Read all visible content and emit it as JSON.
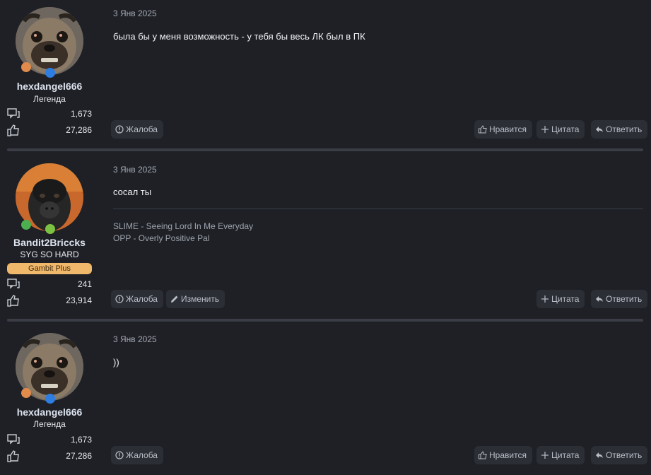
{
  "posts": [
    {
      "user": {
        "name": "hexdangel666",
        "title": "Легенда",
        "messages": "1,673",
        "reactions": "27,286"
      },
      "date": "3 Янв 2025",
      "message": "была бы у меня возможность - у тебя бы весь ЛК был в ПК",
      "actions": {
        "report": "Жалоба",
        "like": "Нравится",
        "quote": "Цитата",
        "reply": "Ответить"
      }
    },
    {
      "user": {
        "name": "Bandit2Briccks",
        "title": "SYG SO HARD",
        "banner": "Gambit Plus",
        "messages": "241",
        "reactions": "23,914"
      },
      "date": "3 Янв 2025",
      "message": "сосал ты",
      "signature": [
        "SLIME - Seeing Lord In Me Everyday",
        "OPP - Overly Positive Pal"
      ],
      "actions": {
        "report": "Жалоба",
        "edit": "Изменить",
        "quote": "Цитата",
        "reply": "Ответить"
      }
    },
    {
      "user": {
        "name": "hexdangel666",
        "title": "Легенда",
        "messages": "1,673",
        "reactions": "27,286"
      },
      "date": "3 Янв 2025",
      "message": "))",
      "actions": {
        "report": "Жалоба",
        "like": "Нравится",
        "quote": "Цитата",
        "reply": "Ответить"
      }
    }
  ],
  "colors": {
    "background": "#1e2026",
    "button": "#2b2e35",
    "banner": "#f0b86a",
    "username": "#dde3ee"
  },
  "icons": {
    "messages": "chat-bubbles-icon",
    "reactions": "thumbs-up-icon",
    "report": "info-circle-icon",
    "like": "thumbs-up-icon",
    "quote": "plus-icon",
    "reply": "reply-arrow-icon",
    "edit": "pencil-icon"
  }
}
